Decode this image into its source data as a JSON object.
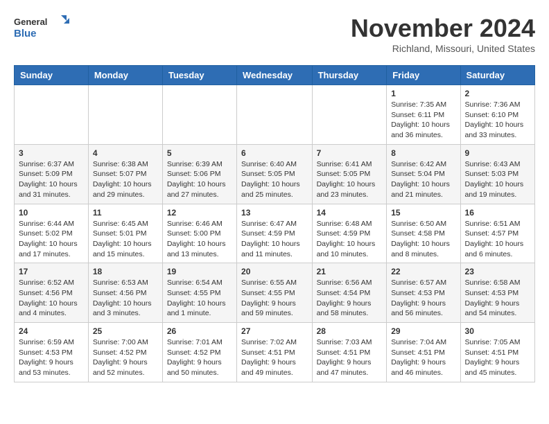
{
  "header": {
    "logo_general": "General",
    "logo_blue": "Blue",
    "month_title": "November 2024",
    "location": "Richland, Missouri, United States"
  },
  "weekdays": [
    "Sunday",
    "Monday",
    "Tuesday",
    "Wednesday",
    "Thursday",
    "Friday",
    "Saturday"
  ],
  "weeks": [
    [
      {
        "day": "",
        "info": ""
      },
      {
        "day": "",
        "info": ""
      },
      {
        "day": "",
        "info": ""
      },
      {
        "day": "",
        "info": ""
      },
      {
        "day": "",
        "info": ""
      },
      {
        "day": "1",
        "info": "Sunrise: 7:35 AM\nSunset: 6:11 PM\nDaylight: 10 hours and 36 minutes."
      },
      {
        "day": "2",
        "info": "Sunrise: 7:36 AM\nSunset: 6:10 PM\nDaylight: 10 hours and 33 minutes."
      }
    ],
    [
      {
        "day": "3",
        "info": "Sunrise: 6:37 AM\nSunset: 5:09 PM\nDaylight: 10 hours and 31 minutes."
      },
      {
        "day": "4",
        "info": "Sunrise: 6:38 AM\nSunset: 5:07 PM\nDaylight: 10 hours and 29 minutes."
      },
      {
        "day": "5",
        "info": "Sunrise: 6:39 AM\nSunset: 5:06 PM\nDaylight: 10 hours and 27 minutes."
      },
      {
        "day": "6",
        "info": "Sunrise: 6:40 AM\nSunset: 5:05 PM\nDaylight: 10 hours and 25 minutes."
      },
      {
        "day": "7",
        "info": "Sunrise: 6:41 AM\nSunset: 5:05 PM\nDaylight: 10 hours and 23 minutes."
      },
      {
        "day": "8",
        "info": "Sunrise: 6:42 AM\nSunset: 5:04 PM\nDaylight: 10 hours and 21 minutes."
      },
      {
        "day": "9",
        "info": "Sunrise: 6:43 AM\nSunset: 5:03 PM\nDaylight: 10 hours and 19 minutes."
      }
    ],
    [
      {
        "day": "10",
        "info": "Sunrise: 6:44 AM\nSunset: 5:02 PM\nDaylight: 10 hours and 17 minutes."
      },
      {
        "day": "11",
        "info": "Sunrise: 6:45 AM\nSunset: 5:01 PM\nDaylight: 10 hours and 15 minutes."
      },
      {
        "day": "12",
        "info": "Sunrise: 6:46 AM\nSunset: 5:00 PM\nDaylight: 10 hours and 13 minutes."
      },
      {
        "day": "13",
        "info": "Sunrise: 6:47 AM\nSunset: 4:59 PM\nDaylight: 10 hours and 11 minutes."
      },
      {
        "day": "14",
        "info": "Sunrise: 6:48 AM\nSunset: 4:59 PM\nDaylight: 10 hours and 10 minutes."
      },
      {
        "day": "15",
        "info": "Sunrise: 6:50 AM\nSunset: 4:58 PM\nDaylight: 10 hours and 8 minutes."
      },
      {
        "day": "16",
        "info": "Sunrise: 6:51 AM\nSunset: 4:57 PM\nDaylight: 10 hours and 6 minutes."
      }
    ],
    [
      {
        "day": "17",
        "info": "Sunrise: 6:52 AM\nSunset: 4:56 PM\nDaylight: 10 hours and 4 minutes."
      },
      {
        "day": "18",
        "info": "Sunrise: 6:53 AM\nSunset: 4:56 PM\nDaylight: 10 hours and 3 minutes."
      },
      {
        "day": "19",
        "info": "Sunrise: 6:54 AM\nSunset: 4:55 PM\nDaylight: 10 hours and 1 minute."
      },
      {
        "day": "20",
        "info": "Sunrise: 6:55 AM\nSunset: 4:55 PM\nDaylight: 9 hours and 59 minutes."
      },
      {
        "day": "21",
        "info": "Sunrise: 6:56 AM\nSunset: 4:54 PM\nDaylight: 9 hours and 58 minutes."
      },
      {
        "day": "22",
        "info": "Sunrise: 6:57 AM\nSunset: 4:53 PM\nDaylight: 9 hours and 56 minutes."
      },
      {
        "day": "23",
        "info": "Sunrise: 6:58 AM\nSunset: 4:53 PM\nDaylight: 9 hours and 54 minutes."
      }
    ],
    [
      {
        "day": "24",
        "info": "Sunrise: 6:59 AM\nSunset: 4:53 PM\nDaylight: 9 hours and 53 minutes."
      },
      {
        "day": "25",
        "info": "Sunrise: 7:00 AM\nSunset: 4:52 PM\nDaylight: 9 hours and 52 minutes."
      },
      {
        "day": "26",
        "info": "Sunrise: 7:01 AM\nSunset: 4:52 PM\nDaylight: 9 hours and 50 minutes."
      },
      {
        "day": "27",
        "info": "Sunrise: 7:02 AM\nSunset: 4:51 PM\nDaylight: 9 hours and 49 minutes."
      },
      {
        "day": "28",
        "info": "Sunrise: 7:03 AM\nSunset: 4:51 PM\nDaylight: 9 hours and 47 minutes."
      },
      {
        "day": "29",
        "info": "Sunrise: 7:04 AM\nSunset: 4:51 PM\nDaylight: 9 hours and 46 minutes."
      },
      {
        "day": "30",
        "info": "Sunrise: 7:05 AM\nSunset: 4:51 PM\nDaylight: 9 hours and 45 minutes."
      }
    ]
  ]
}
